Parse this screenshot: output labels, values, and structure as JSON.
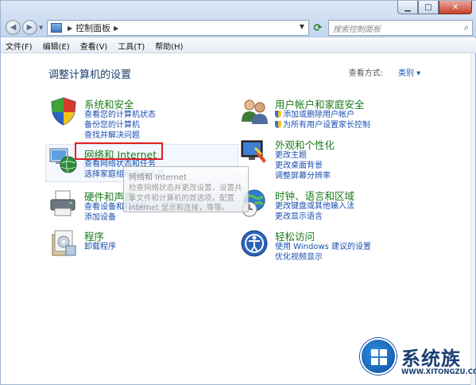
{
  "addressbar": {
    "path": "控制面板",
    "search_placeholder": "搜索控制面板"
  },
  "menu": [
    "文件(F)",
    "编辑(E)",
    "查看(V)",
    "工具(T)",
    "帮助(H)"
  ],
  "page": {
    "title": "调整计算机的设置",
    "view_by_label": "查看方式:",
    "view_by_value": "类别 ▾"
  },
  "categories": {
    "system": {
      "title": "系统和安全",
      "links": [
        "查看您的计算机状态",
        "备份您的计算机",
        "查找并解决问题"
      ]
    },
    "network": {
      "title": "网络和 Internet",
      "links": [
        "查看网络状态和任务",
        "选择家庭组和共享选项"
      ]
    },
    "hardware": {
      "title": "硬件和声音",
      "links": [
        "查看设备和打印机",
        "添加设备"
      ]
    },
    "programs": {
      "title": "程序",
      "links": [
        "卸载程序"
      ]
    },
    "users": {
      "title": "用户帐户和家庭安全",
      "links": [
        "添加或删除用户帐户",
        "为所有用户设置家长控制"
      ]
    },
    "appearance": {
      "title": "外观和个性化",
      "links": [
        "更改主题",
        "更改桌面背景",
        "调整屏幕分辨率"
      ]
    },
    "clock": {
      "title": "时钟、语言和区域",
      "links": [
        "更改键盘或其他输入法",
        "更改显示语言"
      ]
    },
    "ease": {
      "title": "轻松访问",
      "links": [
        "使用 Windows 建议的设置",
        "优化视频显示"
      ]
    }
  },
  "tooltip": {
    "title": "网络和 Internet",
    "body": "检查网络状态并更改设置，设置共享文件和计算机的首选项，配置 Internet 显示和连接，等等。"
  },
  "watermark": {
    "text": "系统族",
    "url": "WWW.XITONGZU.COM"
  },
  "icons": [
    "back-arrow-icon",
    "forward-arrow-icon",
    "control-panel-icon",
    "refresh-icon",
    "search-icon",
    "shield-icon",
    "network-globe-icon",
    "printer-icon",
    "programs-box-icon",
    "users-icon",
    "monitor-paint-icon",
    "globe-clock-icon",
    "accessibility-icon",
    "windows-logo-icon"
  ]
}
